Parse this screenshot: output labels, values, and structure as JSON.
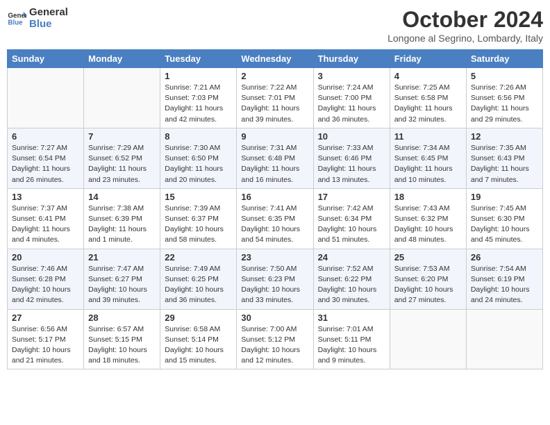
{
  "header": {
    "logo_line1": "General",
    "logo_line2": "Blue",
    "month_title": "October 2024",
    "location": "Longone al Segrino, Lombardy, Italy"
  },
  "days_of_week": [
    "Sunday",
    "Monday",
    "Tuesday",
    "Wednesday",
    "Thursday",
    "Friday",
    "Saturday"
  ],
  "weeks": [
    [
      {
        "day": "",
        "sunrise": "",
        "sunset": "",
        "daylight": "",
        "empty": true
      },
      {
        "day": "",
        "sunrise": "",
        "sunset": "",
        "daylight": "",
        "empty": true
      },
      {
        "day": "1",
        "sunrise": "Sunrise: 7:21 AM",
        "sunset": "Sunset: 7:03 PM",
        "daylight": "Daylight: 11 hours and 42 minutes.",
        "empty": false
      },
      {
        "day": "2",
        "sunrise": "Sunrise: 7:22 AM",
        "sunset": "Sunset: 7:01 PM",
        "daylight": "Daylight: 11 hours and 39 minutes.",
        "empty": false
      },
      {
        "day": "3",
        "sunrise": "Sunrise: 7:24 AM",
        "sunset": "Sunset: 7:00 PM",
        "daylight": "Daylight: 11 hours and 36 minutes.",
        "empty": false
      },
      {
        "day": "4",
        "sunrise": "Sunrise: 7:25 AM",
        "sunset": "Sunset: 6:58 PM",
        "daylight": "Daylight: 11 hours and 32 minutes.",
        "empty": false
      },
      {
        "day": "5",
        "sunrise": "Sunrise: 7:26 AM",
        "sunset": "Sunset: 6:56 PM",
        "daylight": "Daylight: 11 hours and 29 minutes.",
        "empty": false
      }
    ],
    [
      {
        "day": "6",
        "sunrise": "Sunrise: 7:27 AM",
        "sunset": "Sunset: 6:54 PM",
        "daylight": "Daylight: 11 hours and 26 minutes.",
        "empty": false
      },
      {
        "day": "7",
        "sunrise": "Sunrise: 7:29 AM",
        "sunset": "Sunset: 6:52 PM",
        "daylight": "Daylight: 11 hours and 23 minutes.",
        "empty": false
      },
      {
        "day": "8",
        "sunrise": "Sunrise: 7:30 AM",
        "sunset": "Sunset: 6:50 PM",
        "daylight": "Daylight: 11 hours and 20 minutes.",
        "empty": false
      },
      {
        "day": "9",
        "sunrise": "Sunrise: 7:31 AM",
        "sunset": "Sunset: 6:48 PM",
        "daylight": "Daylight: 11 hours and 16 minutes.",
        "empty": false
      },
      {
        "day": "10",
        "sunrise": "Sunrise: 7:33 AM",
        "sunset": "Sunset: 6:46 PM",
        "daylight": "Daylight: 11 hours and 13 minutes.",
        "empty": false
      },
      {
        "day": "11",
        "sunrise": "Sunrise: 7:34 AM",
        "sunset": "Sunset: 6:45 PM",
        "daylight": "Daylight: 11 hours and 10 minutes.",
        "empty": false
      },
      {
        "day": "12",
        "sunrise": "Sunrise: 7:35 AM",
        "sunset": "Sunset: 6:43 PM",
        "daylight": "Daylight: 11 hours and 7 minutes.",
        "empty": false
      }
    ],
    [
      {
        "day": "13",
        "sunrise": "Sunrise: 7:37 AM",
        "sunset": "Sunset: 6:41 PM",
        "daylight": "Daylight: 11 hours and 4 minutes.",
        "empty": false
      },
      {
        "day": "14",
        "sunrise": "Sunrise: 7:38 AM",
        "sunset": "Sunset: 6:39 PM",
        "daylight": "Daylight: 11 hours and 1 minute.",
        "empty": false
      },
      {
        "day": "15",
        "sunrise": "Sunrise: 7:39 AM",
        "sunset": "Sunset: 6:37 PM",
        "daylight": "Daylight: 10 hours and 58 minutes.",
        "empty": false
      },
      {
        "day": "16",
        "sunrise": "Sunrise: 7:41 AM",
        "sunset": "Sunset: 6:35 PM",
        "daylight": "Daylight: 10 hours and 54 minutes.",
        "empty": false
      },
      {
        "day": "17",
        "sunrise": "Sunrise: 7:42 AM",
        "sunset": "Sunset: 6:34 PM",
        "daylight": "Daylight: 10 hours and 51 minutes.",
        "empty": false
      },
      {
        "day": "18",
        "sunrise": "Sunrise: 7:43 AM",
        "sunset": "Sunset: 6:32 PM",
        "daylight": "Daylight: 10 hours and 48 minutes.",
        "empty": false
      },
      {
        "day": "19",
        "sunrise": "Sunrise: 7:45 AM",
        "sunset": "Sunset: 6:30 PM",
        "daylight": "Daylight: 10 hours and 45 minutes.",
        "empty": false
      }
    ],
    [
      {
        "day": "20",
        "sunrise": "Sunrise: 7:46 AM",
        "sunset": "Sunset: 6:28 PM",
        "daylight": "Daylight: 10 hours and 42 minutes.",
        "empty": false
      },
      {
        "day": "21",
        "sunrise": "Sunrise: 7:47 AM",
        "sunset": "Sunset: 6:27 PM",
        "daylight": "Daylight: 10 hours and 39 minutes.",
        "empty": false
      },
      {
        "day": "22",
        "sunrise": "Sunrise: 7:49 AM",
        "sunset": "Sunset: 6:25 PM",
        "daylight": "Daylight: 10 hours and 36 minutes.",
        "empty": false
      },
      {
        "day": "23",
        "sunrise": "Sunrise: 7:50 AM",
        "sunset": "Sunset: 6:23 PM",
        "daylight": "Daylight: 10 hours and 33 minutes.",
        "empty": false
      },
      {
        "day": "24",
        "sunrise": "Sunrise: 7:52 AM",
        "sunset": "Sunset: 6:22 PM",
        "daylight": "Daylight: 10 hours and 30 minutes.",
        "empty": false
      },
      {
        "day": "25",
        "sunrise": "Sunrise: 7:53 AM",
        "sunset": "Sunset: 6:20 PM",
        "daylight": "Daylight: 10 hours and 27 minutes.",
        "empty": false
      },
      {
        "day": "26",
        "sunrise": "Sunrise: 7:54 AM",
        "sunset": "Sunset: 6:19 PM",
        "daylight": "Daylight: 10 hours and 24 minutes.",
        "empty": false
      }
    ],
    [
      {
        "day": "27",
        "sunrise": "Sunrise: 6:56 AM",
        "sunset": "Sunset: 5:17 PM",
        "daylight": "Daylight: 10 hours and 21 minutes.",
        "empty": false
      },
      {
        "day": "28",
        "sunrise": "Sunrise: 6:57 AM",
        "sunset": "Sunset: 5:15 PM",
        "daylight": "Daylight: 10 hours and 18 minutes.",
        "empty": false
      },
      {
        "day": "29",
        "sunrise": "Sunrise: 6:58 AM",
        "sunset": "Sunset: 5:14 PM",
        "daylight": "Daylight: 10 hours and 15 minutes.",
        "empty": false
      },
      {
        "day": "30",
        "sunrise": "Sunrise: 7:00 AM",
        "sunset": "Sunset: 5:12 PM",
        "daylight": "Daylight: 10 hours and 12 minutes.",
        "empty": false
      },
      {
        "day": "31",
        "sunrise": "Sunrise: 7:01 AM",
        "sunset": "Sunset: 5:11 PM",
        "daylight": "Daylight: 10 hours and 9 minutes.",
        "empty": false
      },
      {
        "day": "",
        "sunrise": "",
        "sunset": "",
        "daylight": "",
        "empty": true
      },
      {
        "day": "",
        "sunrise": "",
        "sunset": "",
        "daylight": "",
        "empty": true
      }
    ]
  ]
}
